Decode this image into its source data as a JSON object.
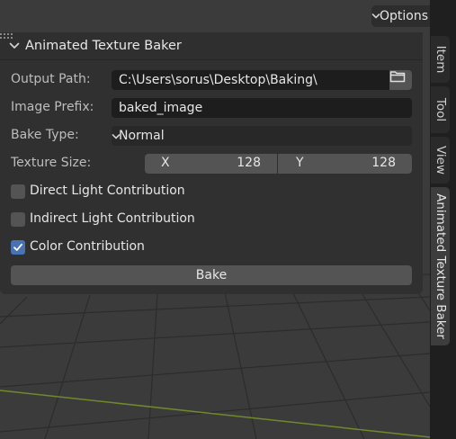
{
  "header": {
    "options_label": "Options"
  },
  "panel": {
    "title": "Animated Texture Baker",
    "output_path": {
      "label": "Output Path:",
      "value": "C:\\Users\\sorus\\Desktop\\Baking\\"
    },
    "image_prefix": {
      "label": "Image Prefix:",
      "value": "baked_image"
    },
    "bake_type": {
      "label": "Bake Type:",
      "value": "Normal"
    },
    "texture_size": {
      "label": "Texture Size:",
      "x_label": "X",
      "x_value": "128",
      "y_label": "Y",
      "y_value": "128"
    },
    "checkboxes": [
      {
        "label": "Direct Light Contribution",
        "checked": false
      },
      {
        "label": "Indirect Light Contribution",
        "checked": false
      },
      {
        "label": "Color Contribution",
        "checked": true
      }
    ],
    "bake_label": "Bake"
  },
  "sidebar_tabs": [
    {
      "label": "Item",
      "active": false
    },
    {
      "label": "Tool",
      "active": false
    },
    {
      "label": "View",
      "active": false
    },
    {
      "label": "Animated Texture Baker",
      "active": true
    }
  ],
  "colors": {
    "accent": "#4772b3",
    "grid_line": "#2e2e2e",
    "x_axis": "#6e8a2a"
  }
}
